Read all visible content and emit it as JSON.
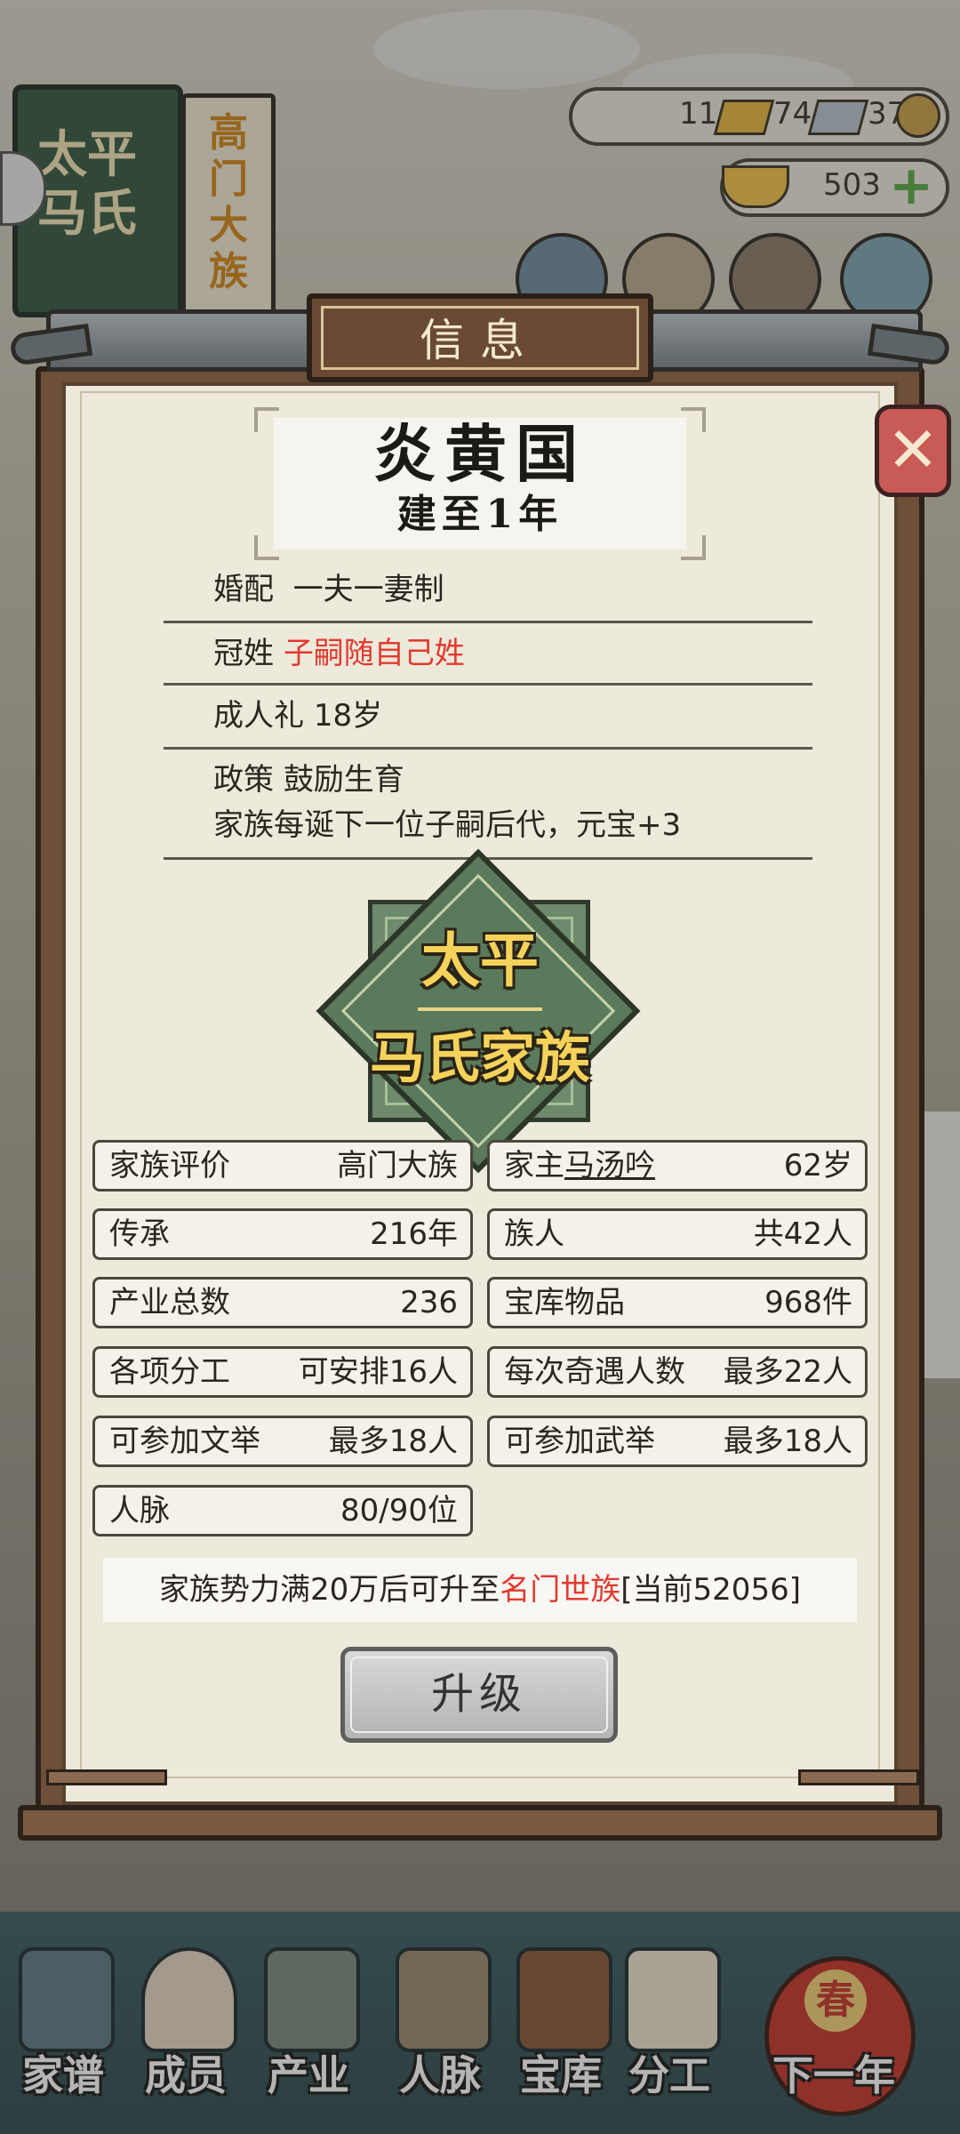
{
  "background": {
    "book": {
      "title": "太平马氏",
      "subtitle": "高门大族"
    },
    "resources": {
      "gold_bar": "11",
      "silver_bar": "74",
      "coin": "37",
      "ingot": "503"
    },
    "bottom_nav": [
      {
        "label": "家谱",
        "icon": "family-tree-icon"
      },
      {
        "label": "成员",
        "icon": "member-icon"
      },
      {
        "label": "产业",
        "icon": "building-icon"
      },
      {
        "label": "人脉",
        "icon": "network-icon"
      },
      {
        "label": "宝库",
        "icon": "treasure-chest-icon"
      },
      {
        "label": "分工",
        "icon": "scroll-icon"
      },
      {
        "label": "下一年",
        "icon": "lantern-icon"
      }
    ],
    "lantern_char": "春"
  },
  "panel": {
    "title": "信息",
    "country": "炎黄国",
    "year": "建至1年",
    "marriage": {
      "label": "婚配",
      "value": "一夫一妻制"
    },
    "surname": {
      "label": "冠姓",
      "value": "子嗣随自己姓"
    },
    "coming_of_age": {
      "label": "成人礼",
      "value": "18岁"
    },
    "policy": {
      "label": "政策",
      "value": "鼓励生育",
      "desc": "家族每诞下一位子嗣后代，元宝+3"
    },
    "emblem": {
      "line1": "太平",
      "line2": "马氏家族"
    },
    "stats": {
      "rating": {
        "label": "家族评价",
        "value": "高门大族"
      },
      "head": {
        "label": "家主",
        "name": "马汤吟",
        "age": "62岁"
      },
      "heritage": {
        "label": "传承",
        "value": "216年"
      },
      "members": {
        "label": "族人",
        "value": "共42人"
      },
      "industry": {
        "label": "产业总数",
        "value": "236"
      },
      "treasury": {
        "label": "宝库物品",
        "value": "968件"
      },
      "division": {
        "label": "各项分工",
        "value": "可安排16人"
      },
      "encounter": {
        "label": "每次奇遇人数",
        "value": "最多22人"
      },
      "civil_exam": {
        "label": "可参加文举",
        "value": "最多18人"
      },
      "military_exam": {
        "label": "可参加武举",
        "value": "最多18人"
      },
      "connections": {
        "label": "人脉",
        "value": "80/90位"
      }
    },
    "note": {
      "prefix": "家族势力满20万后可升至",
      "target": "名门世族",
      "suffix": "[当前52056]"
    },
    "upgrade_label": "升级"
  },
  "colors": {
    "red": "#e23a2f",
    "orange": "#f0a21b",
    "panel_bg": "#ede9db",
    "frame": "#6e4f39"
  }
}
